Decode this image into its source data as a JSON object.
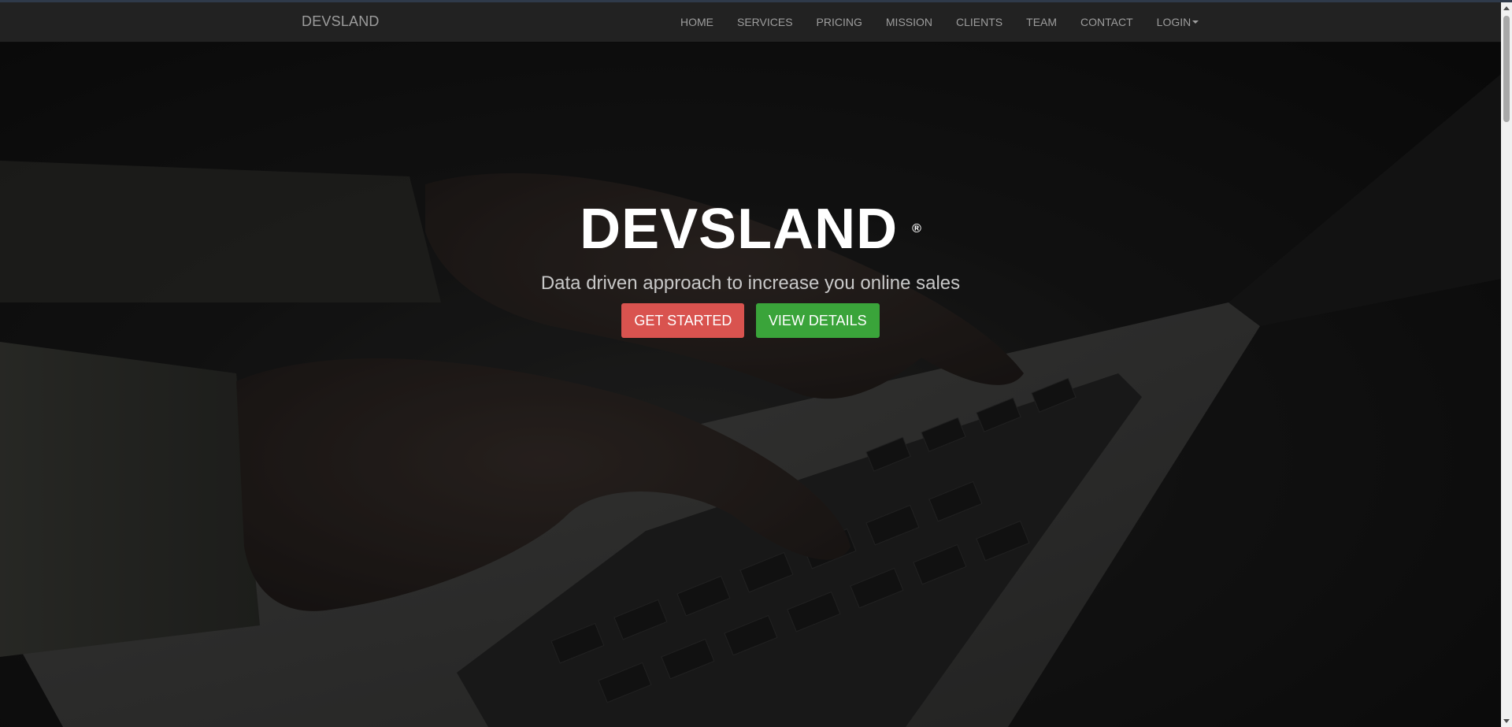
{
  "navbar": {
    "brand": "DEVSLAND",
    "items": [
      {
        "label": "HOME"
      },
      {
        "label": "SERVICES"
      },
      {
        "label": "PRICING"
      },
      {
        "label": "MISSION"
      },
      {
        "label": "CLIENTS"
      },
      {
        "label": "TEAM"
      },
      {
        "label": "CONTACT"
      },
      {
        "label": "LOGIN"
      }
    ]
  },
  "hero": {
    "title": "DEVSLAND",
    "registered_mark": "®",
    "subtitle": "Data driven approach to increase you online sales",
    "buttons": {
      "get_started": "GET STARTED",
      "view_details": "VIEW DETAILS"
    },
    "background_image": "hands typing on laptop keyboard"
  },
  "colors": {
    "navbar_bg": "#222222",
    "nav_text": "#9d9d9d",
    "btn_red": "#d9534f",
    "btn_green": "#3aa43a"
  }
}
